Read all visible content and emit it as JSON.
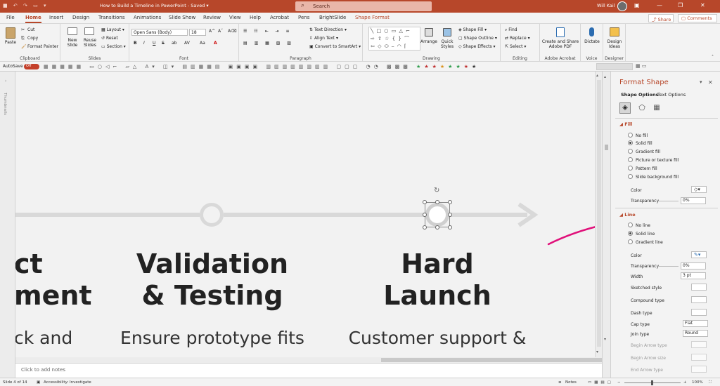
{
  "titlebar": {
    "doc_title": "How to Build a Timeline in PowerPoint  -  Saved  ▾",
    "search_placeholder": "Search",
    "user_name": "Will Kail",
    "qat_icons": [
      "save-icon",
      "undo-icon",
      "redo-icon",
      "present-icon",
      "customize-icon"
    ]
  },
  "tabs": [
    "File",
    "Home",
    "Insert",
    "Design",
    "Transitions",
    "Animations",
    "Slide Show",
    "Review",
    "View",
    "Help",
    "Acrobat",
    "Pens",
    "BrightSlide",
    "Shape Format"
  ],
  "active_tab": "Home",
  "share_label": "Share",
  "comments_label": "Comments",
  "ribbon": {
    "clipboard": {
      "label": "Clipboard",
      "paste": "Paste",
      "cut": "Cut",
      "copy": "Copy",
      "format_painter": "Format Painter"
    },
    "slides": {
      "label": "Slides",
      "new_slide": "New Slide",
      "reuse_slides": "Reuse Slides",
      "layout": "Layout",
      "reset": "Reset",
      "section": "Section"
    },
    "font": {
      "label": "Font",
      "family": "Open Sans (Body)",
      "size": "18",
      "bold": "B",
      "italic": "I",
      "underline": "U",
      "strike": "S",
      "shadow": "ab",
      "spacing": "AV",
      "case": "Aa",
      "font_color": "A"
    },
    "paragraph": {
      "label": "Paragraph",
      "text_direction": "Text Direction",
      "align_text": "Align Text",
      "convert_smartart": "Convert to SmartArt"
    },
    "drawing": {
      "label": "Drawing",
      "arrange": "Arrange",
      "quick_styles": "Quick Styles",
      "shape_fill": "Shape Fill",
      "shape_outline": "Shape Outline",
      "shape_effects": "Shape Effects"
    },
    "editing": {
      "label": "Editing",
      "find": "Find",
      "replace": "Replace",
      "select": "Select"
    },
    "acrobat": {
      "label": "Adobe Acrobat",
      "create": "Create and Share Adobe PDF"
    },
    "voice": {
      "label": "Voice",
      "dictate": "Dictate"
    },
    "designer": {
      "label": "Designer",
      "design_ideas": "Design Ideas"
    }
  },
  "autosave": {
    "label": "AutoSave",
    "state": "Off"
  },
  "slide": {
    "thumb_label": "Thumbnails",
    "milestones": [
      {
        "heading": "ct\nment",
        "body": "ck and"
      },
      {
        "heading": "Validation\n& Testing",
        "body": "Ensure prototype fits"
      },
      {
        "heading": "Hard\nLaunch",
        "body": "Customer support &"
      }
    ]
  },
  "notes_placeholder": "Click to add notes",
  "panel": {
    "title": "Format Shape",
    "tabs": [
      "Shape Options",
      "Text Options"
    ],
    "fill_section": "Fill",
    "fill_options": [
      "No fill",
      "Solid fill",
      "Gradient fill",
      "Picture or texture fill",
      "Pattern fill",
      "Slide background fill"
    ],
    "fill_selected": "Solid fill",
    "color_label": "Color",
    "transparency_label": "Transparency",
    "fill_transparency": "0%",
    "line_section": "Line",
    "line_options": [
      "No line",
      "Solid line",
      "Gradient line"
    ],
    "line_selected": "Solid line",
    "line_color_label": "Color",
    "line_transparency_label": "Transparency",
    "line_transparency": "0%",
    "width_label": "Width",
    "width_value": "3 pt",
    "sketched_label": "Sketched style",
    "compound_label": "Compound type",
    "dash_label": "Dash type",
    "cap_label": "Cap type",
    "cap_value": "Flat",
    "join_label": "Join type",
    "join_value": "Round",
    "begin_arrow_type": "Begin Arrow type",
    "begin_arrow_size": "Begin Arrow size",
    "end_arrow_type": "End Arrow type"
  },
  "status": {
    "slide_info": "Slide 4 of 14",
    "accessibility": "Accessibility: Investigate",
    "notes": "Notes",
    "zoom": "100%"
  },
  "colors": {
    "accent": "#b7472a",
    "annotation": "#e0107a",
    "timeline": "#d9d9d9"
  }
}
